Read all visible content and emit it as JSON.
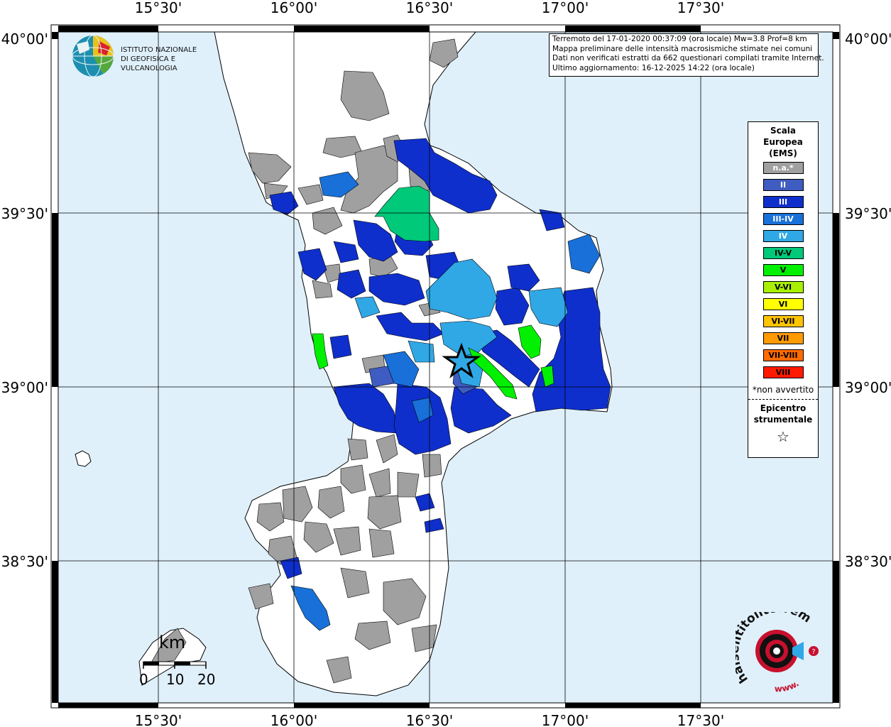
{
  "map": {
    "lon_labels": [
      "15°30'",
      "16°00'",
      "16°30'",
      "17°00'",
      "17°30'"
    ],
    "lat_labels": [
      "40°00'",
      "39°30'",
      "39°00'",
      "38°30'"
    ],
    "colors": {
      "sea": "#dff0fb",
      "land_white": "#ffffff",
      "na": "#a0a0a0",
      "II": "#3e5cc1",
      "III": "#0f2fcc",
      "III-IV": "#1870d8",
      "IV": "#30a8e6",
      "IV-V": "#00c97a",
      "V": "#00f000"
    }
  },
  "info": {
    "line1": "Terremoto del 17-01-2020 00:37:09 (ora locale) Mw=3.8 Prof=8 km",
    "line2": "Mappa preliminare delle intensità macrosismiche stimate nei comuni",
    "line3": "Dati non verificati estratti da 662 questionari compilati tramite Internet.",
    "line4": "Ultimo aggiornamento: 16-12-2025 14:22 (ora locale)"
  },
  "legend": {
    "title_line1": "Scala",
    "title_line2": "Europea",
    "title_line3": "(EMS)",
    "items": [
      {
        "label": "n.a.*",
        "color": "#a0a0a0",
        "text_color": "#ffffff"
      },
      {
        "label": "II",
        "color": "#3e5cc1",
        "text_color": "#ffffff"
      },
      {
        "label": "III",
        "color": "#0f2fcc",
        "text_color": "#ffffff"
      },
      {
        "label": "III-IV",
        "color": "#1870d8",
        "text_color": "#ffffff"
      },
      {
        "label": "IV",
        "color": "#30a8e6",
        "text_color": "#ffffff"
      },
      {
        "label": "IV-V",
        "color": "#00c97a",
        "text_color": "#000000"
      },
      {
        "label": "V",
        "color": "#00f000",
        "text_color": "#000000"
      },
      {
        "label": "V-VI",
        "color": "#a8f000",
        "text_color": "#000000"
      },
      {
        "label": "VI",
        "color": "#ffff00",
        "text_color": "#000000"
      },
      {
        "label": "VI-VII",
        "color": "#ffc400",
        "text_color": "#000000"
      },
      {
        "label": "VII",
        "color": "#ff9a00",
        "text_color": "#000000"
      },
      {
        "label": "VII-VIII",
        "color": "#ff6a00",
        "text_color": "#000000"
      },
      {
        "label": "VIII",
        "color": "#ff1a00",
        "text_color": "#000000"
      }
    ],
    "note": "*non avvertito",
    "epicenter_line1": "Epicentro",
    "epicenter_line2": "strumentale",
    "epicenter_symbol": "☆"
  },
  "logos": {
    "ingv_line1": "ISTITUTO NAZIONALE",
    "ingv_line2": "DI GEOFISICA E VULCANOLOGIA",
    "hsit_text": "haisentitoilterremoto.it",
    "hsit_www": "www."
  },
  "scalebar": {
    "unit": "km",
    "ticks": [
      "0",
      "10",
      "20"
    ]
  }
}
